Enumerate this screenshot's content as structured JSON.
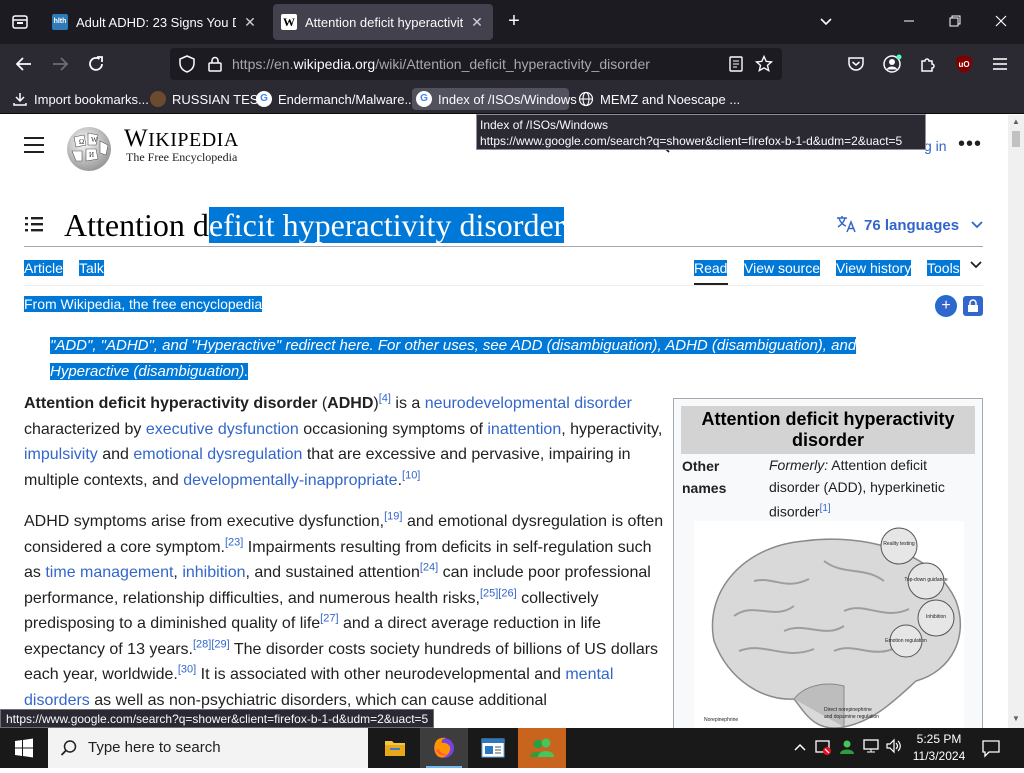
{
  "browser": {
    "tabs": [
      {
        "title": "Adult ADHD: 23 Signs You Do N",
        "favicon": "site-icon"
      },
      {
        "title": "Attention deficit hyperactivity d",
        "favicon": "W",
        "active": true
      }
    ],
    "url_prefix": "https://en.",
    "url_domain": "wikipedia.org",
    "url_path": "/wiki/Attention_deficit_hyperactivity_disorder",
    "extension_badge": "8",
    "bookmarks": [
      {
        "label": "Import bookmarks..."
      },
      {
        "label": "RUSSIAN TEST"
      },
      {
        "label": "Endermanch/Malware..."
      },
      {
        "label": "Index of /ISOs/Windows"
      },
      {
        "label": "MEMZ and Noescape ..."
      }
    ],
    "tooltip": {
      "title": "Index of /ISOs/Windows",
      "url": "https://www.google.com/search?q=shower&client=firefox-b-1-d&udm=2&uact=5"
    },
    "status_url": "https://www.google.com/search?q=shower&client=firefox-b-1-d&udm=2&uact=5"
  },
  "wiki": {
    "wordmark": "Wikipedia",
    "tagline": "The Free Encyclopedia",
    "login": "g in",
    "title_plain": "Attention d",
    "title_selected": "eficit hyperactivity disorder",
    "languages": "76 languages",
    "tabs_left": [
      "Article",
      "Talk"
    ],
    "tabs_right": [
      "Read",
      "View source",
      "View history",
      "Tools"
    ],
    "from": "From Wikipedia, the free encyclopedia",
    "hatnote_line1": "\"ADD\", \"ADHD\", and \"Hyperactive\" redirect here. For other uses, see ADD (disambiguation), ADHD (disambiguation), and",
    "hatnote_line2": "Hyperactive (disambiguation).",
    "infobox": {
      "title": "Attention deficit hyperactivity disorder",
      "label": "Other names",
      "formerly": "Formerly:",
      "value": " Attention deficit disorder (ADD), hyperkinetic disorder",
      "ref": "[1]"
    }
  },
  "taskbar": {
    "search_placeholder": "Type here to search",
    "time": "5:25 PM",
    "date": "11/3/2024"
  },
  "colors": {
    "selection": "#0078d7",
    "link": "#3366cc",
    "chrome_dark": "#1c1b22",
    "toolbar": "#2b2a33"
  }
}
